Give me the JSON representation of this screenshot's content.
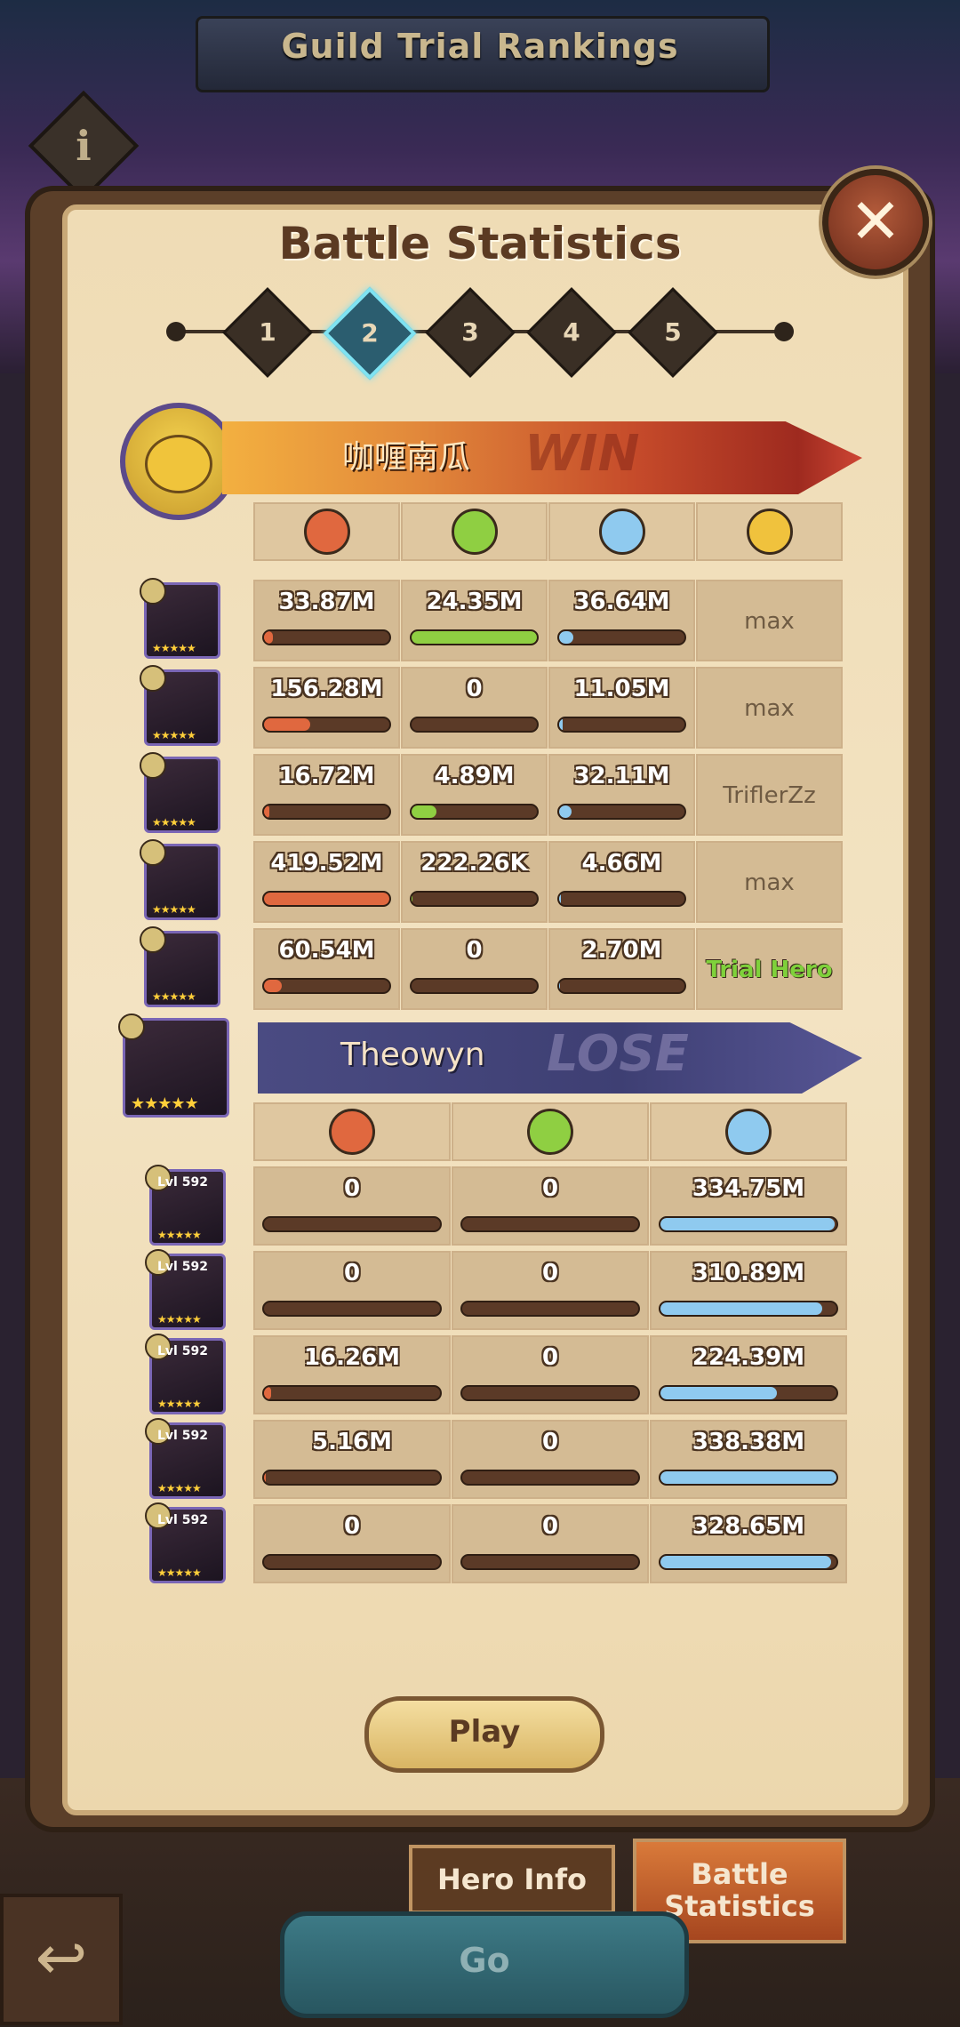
{
  "screen": {
    "title": "Guild Trial Rankings",
    "info_glyph": "i"
  },
  "panel": {
    "title": "Battle Statistics",
    "close_glyph": "✕"
  },
  "stepper": {
    "steps": [
      "1",
      "2",
      "3",
      "4",
      "5"
    ],
    "active": "2"
  },
  "team_a": {
    "player_name": "咖喱南瓜",
    "result": "WIN",
    "column_icons": [
      "attack-icon",
      "heal-icon",
      "shield-icon",
      "player-icon"
    ],
    "rows": [
      {
        "damage": "33.87M",
        "damage_frac": 0.07,
        "heal": "24.35M",
        "heal_frac": 1.0,
        "mitigated": "36.64M",
        "mitigated_frac": 0.11,
        "owner": "max"
      },
      {
        "damage": "156.28M",
        "damage_frac": 0.37,
        "heal": "0",
        "heal_frac": 0,
        "mitigated": "11.05M",
        "mitigated_frac": 0.03,
        "owner": "max"
      },
      {
        "damage": "16.72M",
        "damage_frac": 0.04,
        "heal": "4.89M",
        "heal_frac": 0.2,
        "mitigated": "32.11M",
        "mitigated_frac": 0.1,
        "owner": "TriflerZz"
      },
      {
        "damage": "419.52M",
        "damage_frac": 1.0,
        "heal": "222.26K",
        "heal_frac": 0.01,
        "mitigated": "4.66M",
        "mitigated_frac": 0.015,
        "owner": "max"
      },
      {
        "damage": "60.54M",
        "damage_frac": 0.14,
        "heal": "0",
        "heal_frac": 0,
        "mitigated": "2.70M",
        "mitigated_frac": 0.01,
        "owner": "Trial Hero"
      }
    ]
  },
  "team_b": {
    "player_name": "Theowyn",
    "result": "LOSE",
    "column_icons": [
      "attack-icon",
      "heal-icon",
      "shield-icon"
    ],
    "level_label": "Lvl 592",
    "rows": [
      {
        "damage": "0",
        "damage_frac": 0,
        "heal": "0",
        "heal_frac": 0,
        "mitigated": "334.75M",
        "mitigated_frac": 0.99
      },
      {
        "damage": "0",
        "damage_frac": 0,
        "heal": "0",
        "heal_frac": 0,
        "mitigated": "310.89M",
        "mitigated_frac": 0.92
      },
      {
        "damage": "16.26M",
        "damage_frac": 0.04,
        "heal": "0",
        "heal_frac": 0,
        "mitigated": "224.39M",
        "mitigated_frac": 0.66
      },
      {
        "damage": "5.16M",
        "damage_frac": 0.012,
        "heal": "0",
        "heal_frac": 0,
        "mitigated": "338.38M",
        "mitigated_frac": 1.0
      },
      {
        "damage": "0",
        "damage_frac": 0,
        "heal": "0",
        "heal_frac": 0,
        "mitigated": "328.65M",
        "mitigated_frac": 0.97
      }
    ]
  },
  "buttons": {
    "play": "Play",
    "hero_info": "Hero Info",
    "battle_statistics": "Battle Statistics",
    "go": "Go",
    "back_glyph": "↩"
  },
  "colors": {
    "damage": "#e0683f",
    "heal": "#8fcf42",
    "mitigated": "#8fcaef",
    "trial_hero": "#7fd13b"
  }
}
